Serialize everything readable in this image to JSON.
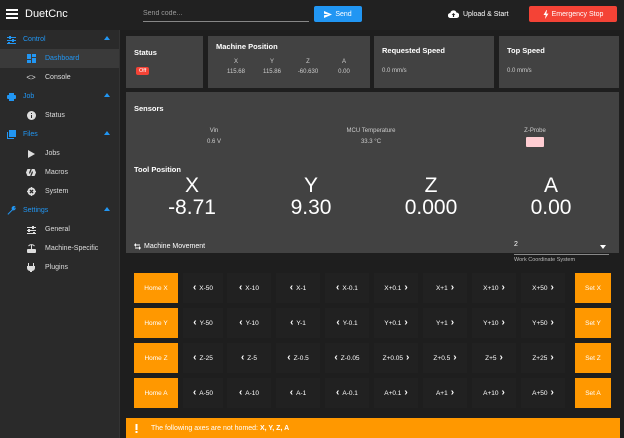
{
  "app": {
    "title": "DuetCnc"
  },
  "topbar": {
    "send_placeholder": "Send code...",
    "send_label": "Send",
    "upload_label": "Upload & Start",
    "estop_label": "Emergency Stop"
  },
  "sidebar": {
    "sections": [
      {
        "label": "Control",
        "items": [
          {
            "label": "Dashboard"
          },
          {
            "label": "Console"
          }
        ]
      },
      {
        "label": "Job",
        "items": [
          {
            "label": "Status"
          }
        ]
      },
      {
        "label": "Files",
        "items": [
          {
            "label": "Jobs"
          },
          {
            "label": "Macros"
          },
          {
            "label": "System"
          }
        ]
      },
      {
        "label": "Settings",
        "items": [
          {
            "label": "General"
          },
          {
            "label": "Machine-Specific"
          },
          {
            "label": "Plugins"
          }
        ]
      }
    ]
  },
  "status_card": {
    "title": "Status",
    "badge": "Off"
  },
  "machine_position": {
    "title": "Machine Position",
    "axes": [
      "X",
      "Y",
      "Z",
      "A"
    ],
    "values": [
      "115.68",
      "115.86",
      "-60.630",
      "0.00"
    ]
  },
  "requested_speed": {
    "title": "Requested Speed",
    "value": "0.0 mm/s"
  },
  "top_speed": {
    "title": "Top Speed",
    "value": "0.0 mm/s"
  },
  "sensors": {
    "title": "Sensors",
    "vin_label": "Vin",
    "vin_value": "0.6 V",
    "mcu_label": "MCU Temperature",
    "mcu_value": "33.3 °C",
    "zprobe_label": "Z-Probe"
  },
  "tool_position": {
    "title": "Tool Position",
    "axes": [
      "X",
      "Y",
      "Z",
      "A"
    ],
    "values": [
      "-8.71",
      "9.30",
      "0.000",
      "0.00"
    ]
  },
  "movement": {
    "title": "Machine Movement",
    "wcs_value": "2",
    "wcs_label": "Work Coordinate System",
    "rows": [
      {
        "home": "Home X",
        "minus": [
          "X-50",
          "X-10",
          "X-1",
          "X-0.1"
        ],
        "plus": [
          "X+0.1",
          "X+1",
          "X+10",
          "X+50"
        ],
        "set": "Set X"
      },
      {
        "home": "Home Y",
        "minus": [
          "Y-50",
          "Y-10",
          "Y-1",
          "Y-0.1"
        ],
        "plus": [
          "Y+0.1",
          "Y+1",
          "Y+10",
          "Y+50"
        ],
        "set": "Set Y"
      },
      {
        "home": "Home Z",
        "minus": [
          "Z-25",
          "Z-5",
          "Z-0.5",
          "Z-0.05"
        ],
        "plus": [
          "Z+0.05",
          "Z+0.5",
          "Z+5",
          "Z+25"
        ],
        "set": "Set Z"
      },
      {
        "home": "Home A",
        "minus": [
          "A-50",
          "A-10",
          "A-1",
          "A-0.1"
        ],
        "plus": [
          "A+0.1",
          "A+1",
          "A+10",
          "A+50"
        ],
        "set": "Set A"
      }
    ]
  },
  "warning": {
    "prefix": "The following axes are not homed: ",
    "axes": "X, Y, Z, A"
  },
  "colors": {
    "accent": "#2196f3",
    "orange": "#ff9800",
    "danger": "#f44336",
    "card": "#424242",
    "background": "#1e1e1e"
  }
}
